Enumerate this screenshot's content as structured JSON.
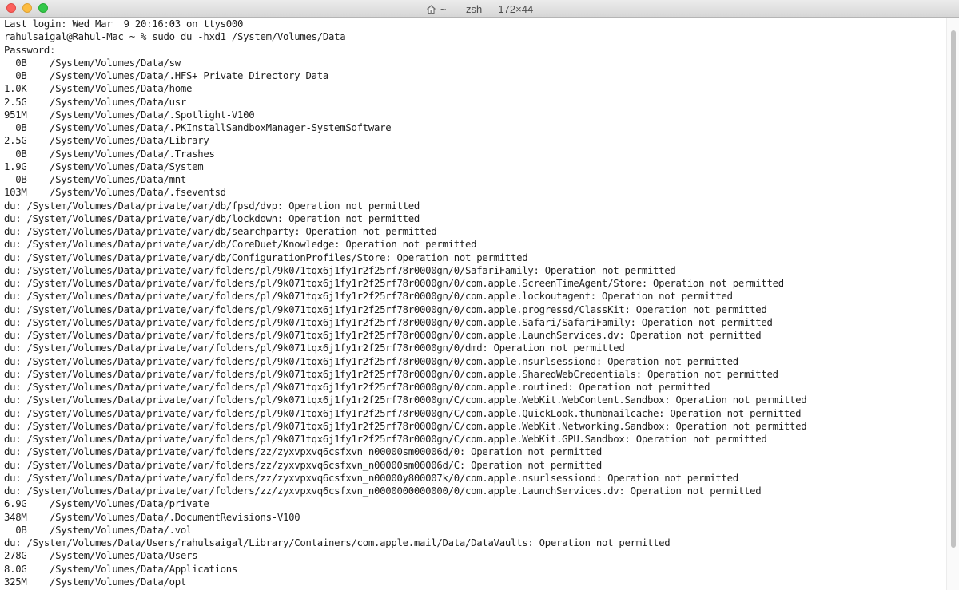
{
  "window": {
    "title": "~ — -zsh — 172×44"
  },
  "icons": {
    "home": "home-icon"
  },
  "terminal": {
    "lines": [
      "Last login: Wed Mar  9 20:16:03 on ttys000",
      "rahulsaigal@Rahul-Mac ~ % sudo du -hxd1 /System/Volumes/Data",
      "Password:",
      "  0B    /System/Volumes/Data/sw",
      "  0B    /System/Volumes/Data/.HFS+ Private Directory Data",
      "1.0K    /System/Volumes/Data/home",
      "2.5G    /System/Volumes/Data/usr",
      "951M    /System/Volumes/Data/.Spotlight-V100",
      "  0B    /System/Volumes/Data/.PKInstallSandboxManager-SystemSoftware",
      "2.5G    /System/Volumes/Data/Library",
      "  0B    /System/Volumes/Data/.Trashes",
      "1.9G    /System/Volumes/Data/System",
      "  0B    /System/Volumes/Data/mnt",
      "103M    /System/Volumes/Data/.fseventsd",
      "du: /System/Volumes/Data/private/var/db/fpsd/dvp: Operation not permitted",
      "du: /System/Volumes/Data/private/var/db/lockdown: Operation not permitted",
      "du: /System/Volumes/Data/private/var/db/searchparty: Operation not permitted",
      "du: /System/Volumes/Data/private/var/db/CoreDuet/Knowledge: Operation not permitted",
      "du: /System/Volumes/Data/private/var/db/ConfigurationProfiles/Store: Operation not permitted",
      "du: /System/Volumes/Data/private/var/folders/pl/9k071tqx6j1fy1r2f25rf78r0000gn/0/SafariFamily: Operation not permitted",
      "du: /System/Volumes/Data/private/var/folders/pl/9k071tqx6j1fy1r2f25rf78r0000gn/0/com.apple.ScreenTimeAgent/Store: Operation not permitted",
      "du: /System/Volumes/Data/private/var/folders/pl/9k071tqx6j1fy1r2f25rf78r0000gn/0/com.apple.lockoutagent: Operation not permitted",
      "du: /System/Volumes/Data/private/var/folders/pl/9k071tqx6j1fy1r2f25rf78r0000gn/0/com.apple.progressd/ClassKit: Operation not permitted",
      "du: /System/Volumes/Data/private/var/folders/pl/9k071tqx6j1fy1r2f25rf78r0000gn/0/com.apple.Safari/SafariFamily: Operation not permitted",
      "du: /System/Volumes/Data/private/var/folders/pl/9k071tqx6j1fy1r2f25rf78r0000gn/0/com.apple.LaunchServices.dv: Operation not permitted",
      "du: /System/Volumes/Data/private/var/folders/pl/9k071tqx6j1fy1r2f25rf78r0000gn/0/dmd: Operation not permitted",
      "du: /System/Volumes/Data/private/var/folders/pl/9k071tqx6j1fy1r2f25rf78r0000gn/0/com.apple.nsurlsessiond: Operation not permitted",
      "du: /System/Volumes/Data/private/var/folders/pl/9k071tqx6j1fy1r2f25rf78r0000gn/0/com.apple.SharedWebCredentials: Operation not permitted",
      "du: /System/Volumes/Data/private/var/folders/pl/9k071tqx6j1fy1r2f25rf78r0000gn/0/com.apple.routined: Operation not permitted",
      "du: /System/Volumes/Data/private/var/folders/pl/9k071tqx6j1fy1r2f25rf78r0000gn/C/com.apple.WebKit.WebContent.Sandbox: Operation not permitted",
      "du: /System/Volumes/Data/private/var/folders/pl/9k071tqx6j1fy1r2f25rf78r0000gn/C/com.apple.QuickLook.thumbnailcache: Operation not permitted",
      "du: /System/Volumes/Data/private/var/folders/pl/9k071tqx6j1fy1r2f25rf78r0000gn/C/com.apple.WebKit.Networking.Sandbox: Operation not permitted",
      "du: /System/Volumes/Data/private/var/folders/pl/9k071tqx6j1fy1r2f25rf78r0000gn/C/com.apple.WebKit.GPU.Sandbox: Operation not permitted",
      "du: /System/Volumes/Data/private/var/folders/zz/zyxvpxvq6csfxvn_n00000sm00006d/0: Operation not permitted",
      "du: /System/Volumes/Data/private/var/folders/zz/zyxvpxvq6csfxvn_n00000sm00006d/C: Operation not permitted",
      "du: /System/Volumes/Data/private/var/folders/zz/zyxvpxvq6csfxvn_n00000y800007k/0/com.apple.nsurlsessiond: Operation not permitted",
      "du: /System/Volumes/Data/private/var/folders/zz/zyxvpxvq6csfxvn_n0000000000000/0/com.apple.LaunchServices.dv: Operation not permitted",
      "6.9G    /System/Volumes/Data/private",
      "348M    /System/Volumes/Data/.DocumentRevisions-V100",
      "  0B    /System/Volumes/Data/.vol",
      "du: /System/Volumes/Data/Users/rahulsaigal/Library/Containers/com.apple.mail/Data/DataVaults: Operation not permitted",
      "278G    /System/Volumes/Data/Users",
      "8.0G    /System/Volumes/Data/Applications",
      "325M    /System/Volumes/Data/opt"
    ]
  }
}
